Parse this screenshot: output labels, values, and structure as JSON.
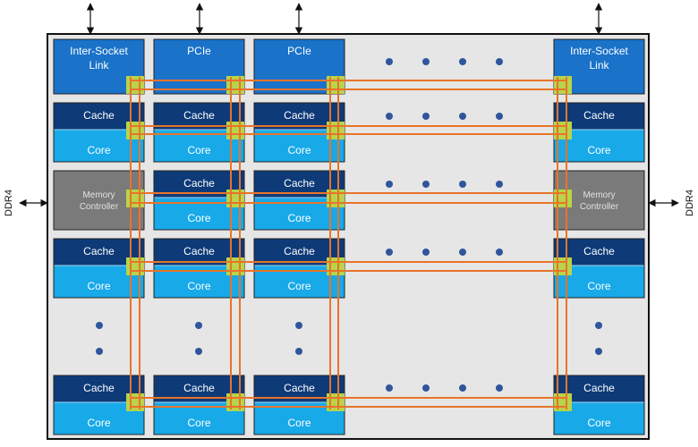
{
  "diagram": {
    "external": {
      "top_link_count": 4,
      "left_label": "DDR4",
      "right_label": "DDR4"
    },
    "colors": {
      "die_background": "#e6e6e6",
      "die_border": "#111111",
      "io_tile": "#1a72c9",
      "cache": "#0e3a78",
      "core": "#18a9e8",
      "memory_controller": "#7a7a7a",
      "mesh_stop": "#b7d44a",
      "mesh_line": "#e8742a",
      "ellipsis_dot": "#2f569c",
      "tile_border": "#222222"
    },
    "rows": [
      {
        "kind": "tiles",
        "tiles": [
          {
            "type": "io",
            "lines": [
              "Inter-Socket",
              "Link"
            ]
          },
          {
            "type": "io",
            "lines": [
              "PCIe"
            ]
          },
          {
            "type": "io",
            "lines": [
              "PCIe"
            ]
          },
          {
            "type": "ellipsis"
          },
          {
            "type": "io",
            "lines": [
              "Inter-Socket",
              "Link"
            ]
          }
        ]
      },
      {
        "kind": "tiles",
        "tiles": [
          {
            "type": "core",
            "lines": [
              "Cache",
              "Core"
            ]
          },
          {
            "type": "core",
            "lines": [
              "Cache",
              "Core"
            ]
          },
          {
            "type": "core",
            "lines": [
              "Cache",
              "Core"
            ]
          },
          {
            "type": "ellipsis"
          },
          {
            "type": "core",
            "lines": [
              "Cache",
              "Core"
            ]
          }
        ]
      },
      {
        "kind": "tiles",
        "tiles": [
          {
            "type": "mc",
            "lines": [
              "Memory",
              "Controller"
            ]
          },
          {
            "type": "core",
            "lines": [
              "Cache",
              "Core"
            ]
          },
          {
            "type": "core",
            "lines": [
              "Cache",
              "Core"
            ]
          },
          {
            "type": "ellipsis"
          },
          {
            "type": "mc",
            "lines": [
              "Memory",
              "Controller"
            ]
          }
        ]
      },
      {
        "kind": "tiles",
        "tiles": [
          {
            "type": "core",
            "lines": [
              "Cache",
              "Core"
            ]
          },
          {
            "type": "core",
            "lines": [
              "Cache",
              "Core"
            ]
          },
          {
            "type": "core",
            "lines": [
              "Cache",
              "Core"
            ]
          },
          {
            "type": "ellipsis"
          },
          {
            "type": "core",
            "lines": [
              "Cache",
              "Core"
            ]
          }
        ]
      },
      {
        "kind": "vertical-ellipsis"
      },
      {
        "kind": "tiles",
        "tiles": [
          {
            "type": "core",
            "lines": [
              "Cache",
              "Core"
            ]
          },
          {
            "type": "core",
            "lines": [
              "Cache",
              "Core"
            ]
          },
          {
            "type": "core",
            "lines": [
              "Cache",
              "Core"
            ]
          },
          {
            "type": "ellipsis"
          },
          {
            "type": "core",
            "lines": [
              "Cache",
              "Core"
            ]
          }
        ]
      }
    ]
  }
}
